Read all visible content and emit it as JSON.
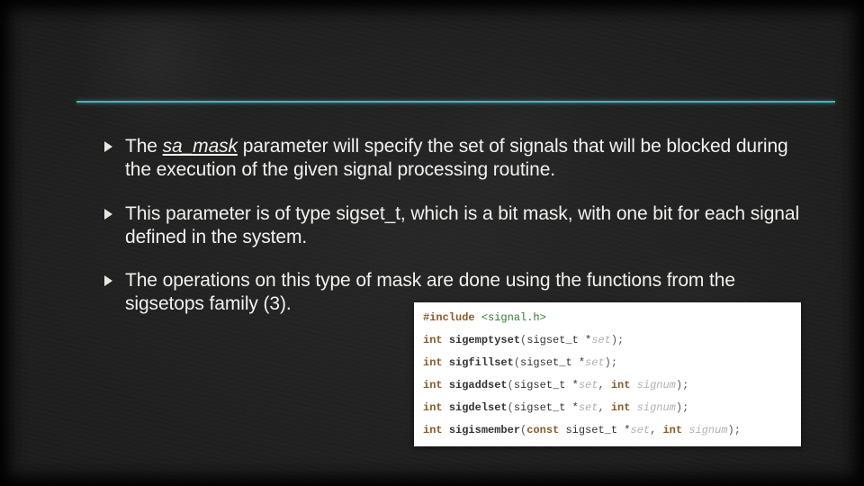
{
  "bullets": [
    {
      "pre": "The ",
      "keyword": "sa_mask",
      "post": " parameter will specify the set of signals that will be blocked during the execution of the given signal processing routine."
    },
    {
      "pre": "",
      "keyword": "",
      "post": "This parameter is of type sigset_t, which is a bit mask, with one bit for each signal defined in the system."
    },
    {
      "pre": "",
      "keyword": "",
      "post": "The operations on this type of mask are done using the functions from the sigsetops family (3)."
    }
  ],
  "code": {
    "include_directive": "#include",
    "include_header": "<signal.h>",
    "lines": [
      {
        "ret": "int",
        "fn": "sigemptyset",
        "args": [
          {
            "t": "sigset_t *",
            "v": "set"
          }
        ]
      },
      {
        "ret": "int",
        "fn": "sigfillset",
        "args": [
          {
            "t": "sigset_t *",
            "v": "set"
          }
        ]
      },
      {
        "ret": "int",
        "fn": "sigaddset",
        "args": [
          {
            "t": "sigset_t *",
            "v": "set"
          },
          {
            "t": "int ",
            "v": "signum"
          }
        ]
      },
      {
        "ret": "int",
        "fn": "sigdelset",
        "args": [
          {
            "t": "sigset_t *",
            "v": "set"
          },
          {
            "t": "int ",
            "v": "signum"
          }
        ]
      },
      {
        "ret": "int",
        "fn": "sigismember",
        "args": [
          {
            "t": "const sigset_t *",
            "v": "set"
          },
          {
            "t": "int ",
            "v": "signum"
          }
        ]
      }
    ]
  }
}
